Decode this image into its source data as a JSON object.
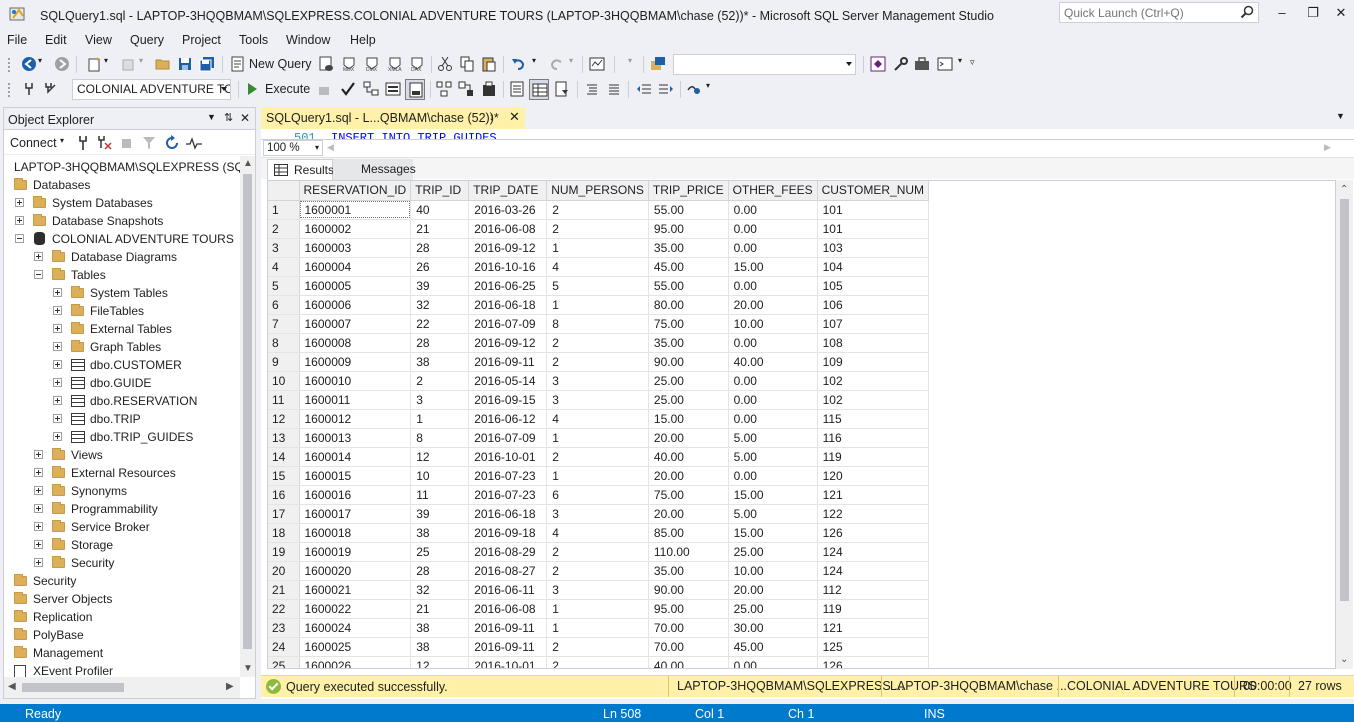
{
  "window": {
    "title": "SQLQuery1.sql - LAPTOP-3HQQBMAM\\SQLEXPRESS.COLONIAL ADVENTURE TOURS (LAPTOP-3HQQBMAM\\chase (52))* - Microsoft SQL Server Management Studio",
    "quick_launch_placeholder": "Quick Launch (Ctrl+Q)"
  },
  "menu": [
    "File",
    "Edit",
    "View",
    "Query",
    "Project",
    "Tools",
    "Window",
    "Help"
  ],
  "toolbar": {
    "new_query_label": "New Query",
    "database_selector": "COLONIAL ADVENTURE TO",
    "execute_label": "Execute"
  },
  "object_explorer": {
    "title": "Object Explorer",
    "connect_label": "Connect",
    "server_node": "LAPTOP-3HQQBMAM\\SQLEXPRESS (SQL S",
    "nodes": {
      "databases": "Databases",
      "system_databases": "System Databases",
      "database_snapshots": "Database Snapshots",
      "colonial_db": "COLONIAL ADVENTURE TOURS",
      "database_diagrams": "Database Diagrams",
      "tables": "Tables",
      "system_tables": "System Tables",
      "file_tables": "FileTables",
      "external_tables": "External Tables",
      "graph_tables": "Graph Tables",
      "customer": "dbo.CUSTOMER",
      "guide": "dbo.GUIDE",
      "reservation": "dbo.RESERVATION",
      "trip": "dbo.TRIP",
      "trip_guides": "dbo.TRIP_GUIDES",
      "views": "Views",
      "external_resources": "External Resources",
      "synonyms": "Synonyms",
      "programmability": "Programmability",
      "service_broker": "Service Broker",
      "storage": "Storage",
      "db_security": "Security",
      "security": "Security",
      "server_objects": "Server Objects",
      "replication": "Replication",
      "polybase": "PolyBase",
      "management": "Management",
      "xevent": "XEvent Profiler"
    }
  },
  "editor": {
    "tab_title": "SQLQuery1.sql - L...QBMAM\\chase (52))*",
    "line_number": "501",
    "code_line": "INSERT INTO TRIP_GUIDES",
    "zoom": "100 %",
    "results_tab": "Results",
    "messages_tab": "Messages"
  },
  "results": {
    "columns": [
      "RESERVATION_ID",
      "TRIP_ID",
      "TRIP_DATE",
      "NUM_PERSONS",
      "TRIP_PRICE",
      "OTHER_FEES",
      "CUSTOMER_NUM"
    ],
    "rows": [
      [
        "1",
        "1600001",
        "40",
        "2016-03-26",
        "2",
        "55.00",
        "0.00",
        "101"
      ],
      [
        "2",
        "1600002",
        "21",
        "2016-06-08",
        "2",
        "95.00",
        "0.00",
        "101"
      ],
      [
        "3",
        "1600003",
        "28",
        "2016-09-12",
        "1",
        "35.00",
        "0.00",
        "103"
      ],
      [
        "4",
        "1600004",
        "26",
        "2016-10-16",
        "4",
        "45.00",
        "15.00",
        "104"
      ],
      [
        "5",
        "1600005",
        "39",
        "2016-06-25",
        "5",
        "55.00",
        "0.00",
        "105"
      ],
      [
        "6",
        "1600006",
        "32",
        "2016-06-18",
        "1",
        "80.00",
        "20.00",
        "106"
      ],
      [
        "7",
        "1600007",
        "22",
        "2016-07-09",
        "8",
        "75.00",
        "10.00",
        "107"
      ],
      [
        "8",
        "1600008",
        "28",
        "2016-09-12",
        "2",
        "35.00",
        "0.00",
        "108"
      ],
      [
        "9",
        "1600009",
        "38",
        "2016-09-11",
        "2",
        "90.00",
        "40.00",
        "109"
      ],
      [
        "10",
        "1600010",
        "2",
        "2016-05-14",
        "3",
        "25.00",
        "0.00",
        "102"
      ],
      [
        "11",
        "1600011",
        "3",
        "2016-09-15",
        "3",
        "25.00",
        "0.00",
        "102"
      ],
      [
        "12",
        "1600012",
        "1",
        "2016-06-12",
        "4",
        "15.00",
        "0.00",
        "115"
      ],
      [
        "13",
        "1600013",
        "8",
        "2016-07-09",
        "1",
        "20.00",
        "5.00",
        "116"
      ],
      [
        "14",
        "1600014",
        "12",
        "2016-10-01",
        "2",
        "40.00",
        "5.00",
        "119"
      ],
      [
        "15",
        "1600015",
        "10",
        "2016-07-23",
        "1",
        "20.00",
        "0.00",
        "120"
      ],
      [
        "16",
        "1600016",
        "11",
        "2016-07-23",
        "6",
        "75.00",
        "15.00",
        "121"
      ],
      [
        "17",
        "1600017",
        "39",
        "2016-06-18",
        "3",
        "20.00",
        "5.00",
        "122"
      ],
      [
        "18",
        "1600018",
        "38",
        "2016-09-18",
        "4",
        "85.00",
        "15.00",
        "126"
      ],
      [
        "19",
        "1600019",
        "25",
        "2016-08-29",
        "2",
        "110.00",
        "25.00",
        "124"
      ],
      [
        "20",
        "1600020",
        "28",
        "2016-08-27",
        "2",
        "35.00",
        "10.00",
        "124"
      ],
      [
        "21",
        "1600021",
        "32",
        "2016-06-11",
        "3",
        "90.00",
        "20.00",
        "112"
      ],
      [
        "22",
        "1600022",
        "21",
        "2016-06-08",
        "1",
        "95.00",
        "25.00",
        "119"
      ],
      [
        "23",
        "1600024",
        "38",
        "2016-09-11",
        "1",
        "70.00",
        "30.00",
        "121"
      ],
      [
        "24",
        "1600025",
        "38",
        "2016-09-11",
        "2",
        "70.00",
        "45.00",
        "125"
      ],
      [
        "25",
        "1600026",
        "12",
        "2016-10-01",
        "2",
        "40.00",
        "0.00",
        "126"
      ]
    ]
  },
  "query_status": {
    "message": "Query executed successfully.",
    "server": "LAPTOP-3HQQBMAM\\SQLEXPRESS ...",
    "user": "LAPTOP-3HQQBMAM\\chase ...",
    "database": "COLONIAL ADVENTURE TOURS",
    "elapsed": "00:00:00",
    "rows": "27 rows"
  },
  "status_bar": {
    "state": "Ready",
    "line": "Ln 508",
    "col": "Col 1",
    "ch": "Ch 1",
    "mode": "INS"
  },
  "colors": {
    "accent": "#007acc",
    "tab_highlight": "#fff1a8",
    "chrome": "#eef0f5",
    "folder": "#dcb05b"
  }
}
